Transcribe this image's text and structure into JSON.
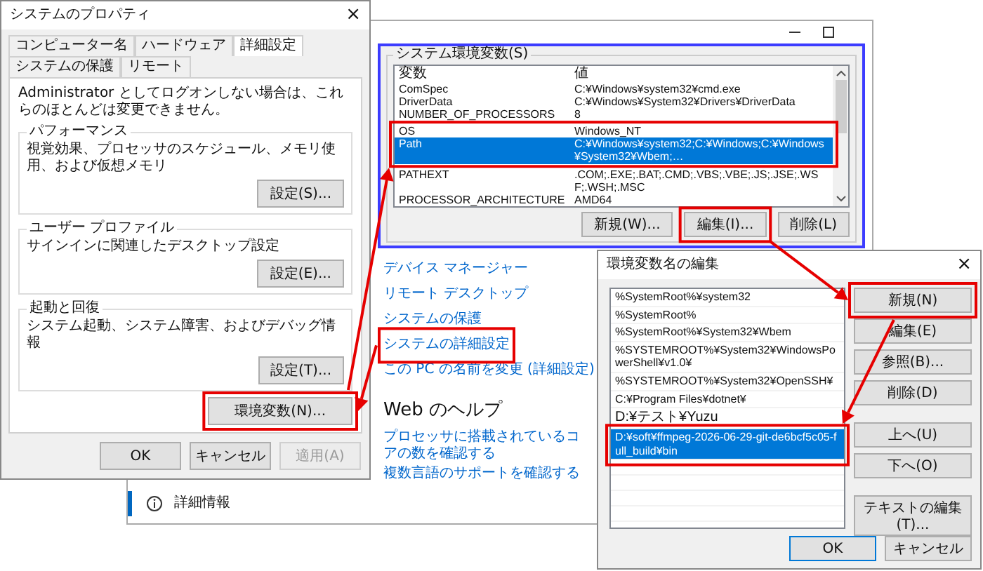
{
  "system_properties": {
    "title": "システムのプロパティ",
    "close": "×",
    "tabs": [
      {
        "label": "コンピューター名",
        "selected": false
      },
      {
        "label": "ハードウェア",
        "selected": false
      },
      {
        "label": "詳細設定",
        "selected": true
      },
      {
        "label": "システムの保護",
        "selected": false
      },
      {
        "label": "リモート",
        "selected": false
      }
    ],
    "note": "Administrator としてログオンしない場合は、これらのほとんどは変更できません。",
    "groups": [
      {
        "title": "パフォーマンス",
        "description": "視覚効果、プロセッサのスケジュール、メモリ使用、および仮想メモリ",
        "button": "設定(S)..."
      },
      {
        "title": "ユーザー プロファイル",
        "description": "サインインに関連したデスクトップ設定",
        "button": "設定(E)..."
      },
      {
        "title": "起動と回復",
        "description": "システム起動、システム障害、およびデバッグ情報",
        "button": "設定(T)..."
      }
    ],
    "env_button": "環境変数(N)...",
    "buttons": [
      {
        "label": "OK",
        "disabled": false
      },
      {
        "label": "キャンセル",
        "disabled": false
      },
      {
        "label": "適用(A)",
        "disabled": true
      }
    ]
  },
  "settings_window": {
    "system_variables": {
      "label": "システム環境変数(S)",
      "columns": [
        "変数",
        "値"
      ],
      "rows": [
        {
          "name": "ComSpec",
          "value": "C:¥Windows¥system32¥cmd.exe",
          "selected": false
        },
        {
          "name": "DriverData",
          "value": "C:¥Windows¥System32¥Drivers¥DriverData",
          "selected": false
        },
        {
          "name": "NUMBER_OF_PROCESSORS",
          "value": "8",
          "selected": false
        },
        {
          "name": "OS",
          "value": "Windows_NT",
          "selected": false
        },
        {
          "name": "Path",
          "value": "C:¥Windows¥system32;C:¥Windows;C:¥Windows¥System32¥Wbem;…",
          "selected": true
        },
        {
          "name": "PATHEXT",
          "value": ".COM;.EXE;.BAT;.CMD;.VBS;.VBE;.JS;.JSE;.WSF;.WSH;.MSC",
          "selected": false
        },
        {
          "name": "PROCESSOR_ARCHITECTURE",
          "value": "AMD64",
          "selected": false
        }
      ],
      "buttons": [
        "新規(W)...",
        "編集(I)...",
        "削除(L)"
      ]
    },
    "links": [
      "デバイス マネージャー",
      "リモート デスクトップ",
      "システムの保護",
      "システムの詳細設定",
      "この PC の名前を変更 (詳細設定)"
    ],
    "web_help": {
      "heading": "Web のヘルプ",
      "links": [
        "プロセッサに搭載されているコアの数を確認する",
        "複数言語のサポートを確認する"
      ]
    },
    "nav_item": {
      "label": "詳細情報",
      "selected": true
    }
  },
  "edit_dialog": {
    "title": "環境変数名の編集",
    "close": "×",
    "items": [
      {
        "text": "%SystemRoot%¥system32",
        "selected": false
      },
      {
        "text": "%SystemRoot%",
        "selected": false
      },
      {
        "text": "%SystemRoot%¥System32¥Wbem",
        "selected": false
      },
      {
        "text": "%SYSTEMROOT%¥System32¥WindowsPowerShell¥v1.0¥",
        "selected": false
      },
      {
        "text": "%SYSTEMROOT%¥System32¥OpenSSH¥",
        "selected": false
      },
      {
        "text": "C:¥Program Files¥dotnet¥",
        "selected": false
      },
      {
        "text": "D:¥テスト¥Yuzu",
        "selected": false
      },
      {
        "text": "D:¥soft¥ffmpeg-2026-06-29-git-de6bcf5c05-full_build¥bin",
        "selected": true
      }
    ],
    "buttons": [
      "新規(N)",
      "編集(E)",
      "参照(B)...",
      "削除(D)",
      "上へ(U)",
      "下へ(O)",
      "テキストの編集(T)..."
    ],
    "footer_buttons": [
      "OK",
      "キャンセル"
    ]
  }
}
